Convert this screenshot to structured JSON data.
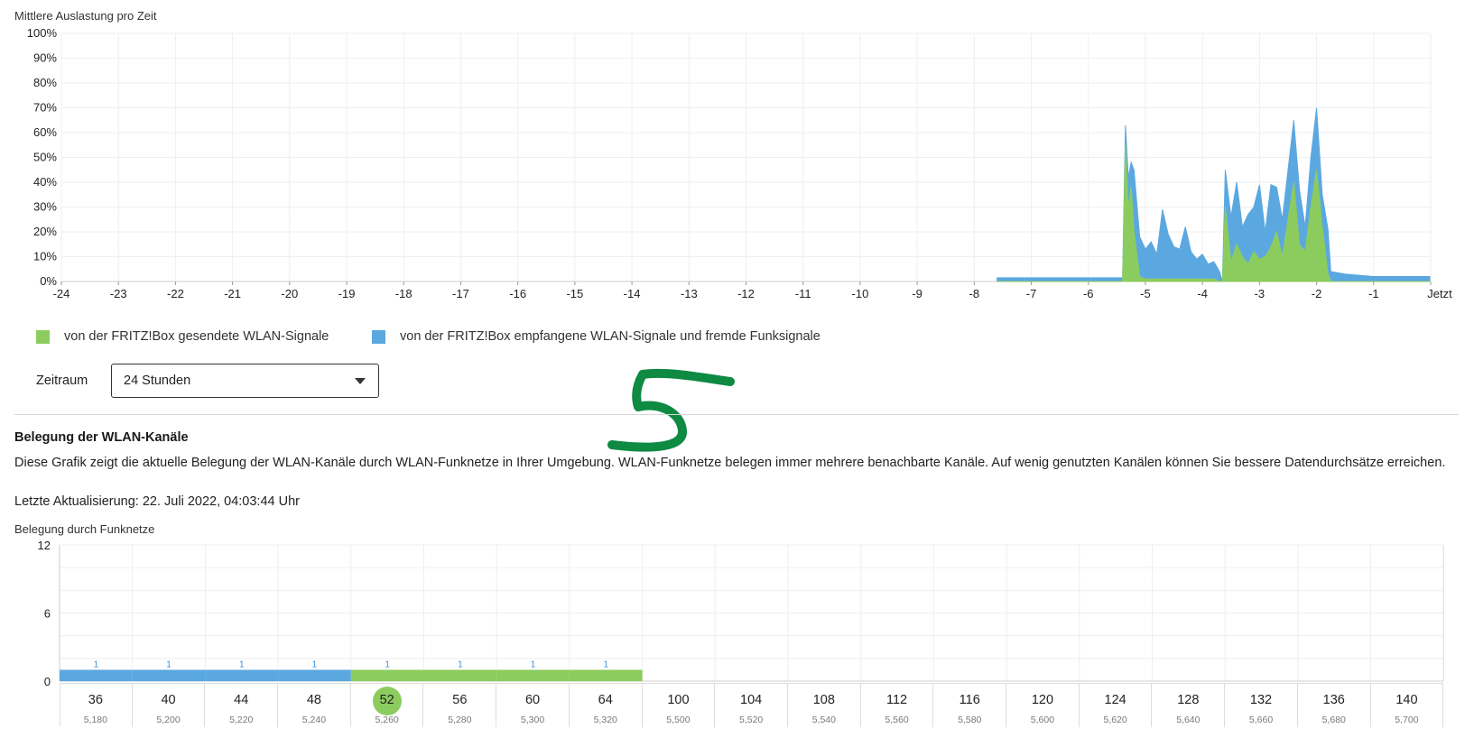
{
  "utilization": {
    "title": "Mittlere Auslastung pro Zeit",
    "legend": [
      {
        "label": "von der FRITZ!Box gesendete WLAN-Signale",
        "color": "#8ccc5e"
      },
      {
        "label": "von der FRITZ!Box empfangene WLAN-Signale und fremde Funksignale",
        "color": "#5ba8e0"
      }
    ]
  },
  "period": {
    "label": "Zeitraum",
    "value": "24 Stunden"
  },
  "channels_section": {
    "title": "Belegung der WLAN-Kanäle",
    "description": "Diese Grafik zeigt die aktuelle Belegung der WLAN-Kanäle durch WLAN-Funknetze in Ihrer Umgebung. WLAN-Funknetze belegen immer mehrere benachbarte Kanäle. Auf wenig genutzten Kanälen können Sie bessere Datendurchsätze erreichen.",
    "last_update": "Letzte Aktualisierung: 22. Juli 2022, 04:03:44 Uhr",
    "chart_title": "Belegung durch Funknetze",
    "annotation": "5"
  },
  "chart_data": [
    {
      "type": "area",
      "title": "Mittlere Auslastung pro Zeit",
      "xlabel": "",
      "ylabel": "",
      "x_ticks": [
        "-24",
        "-23",
        "-22",
        "-21",
        "-20",
        "-19",
        "-18",
        "-17",
        "-16",
        "-15",
        "-14",
        "-13",
        "-12",
        "-11",
        "-10",
        "-9",
        "-8",
        "-7",
        "-6",
        "-5",
        "-4",
        "-3",
        "-2",
        "-1",
        "Jetzt"
      ],
      "y_ticks": [
        "0%",
        "10%",
        "20%",
        "30%",
        "40%",
        "50%",
        "60%",
        "70%",
        "80%",
        "90%",
        "100%"
      ],
      "xlim": [
        -24,
        0
      ],
      "ylim": [
        0,
        100
      ],
      "grid": true,
      "legend_position": "bottom-left",
      "series": [
        {
          "name": "von der FRITZ!Box gesendete WLAN-Signale",
          "color": "#8ccc5e",
          "x": [
            -7.6,
            -5.4,
            -5.35,
            -5.3,
            -5.25,
            -5.2,
            -5.1,
            -5.0,
            -4.9,
            -4.8,
            -4.7,
            -4.6,
            -4.5,
            -4.4,
            -4.3,
            -4.2,
            -4.1,
            -4.0,
            -3.9,
            -3.8,
            -3.7,
            -3.65,
            -3.6,
            -3.5,
            -3.4,
            -3.3,
            -3.2,
            -3.1,
            -3.0,
            -2.9,
            -2.8,
            -2.7,
            -2.6,
            -2.5,
            -2.4,
            -2.3,
            -2.2,
            -2.1,
            -2.0,
            -1.9,
            -1.8,
            -1.75,
            -1.5,
            -1.0,
            -0.5,
            0
          ],
          "y": [
            0,
            0,
            55,
            30,
            38,
            20,
            2,
            1,
            1,
            1,
            1,
            1,
            1,
            1,
            1,
            1,
            1,
            1,
            1,
            1,
            0,
            0,
            30,
            8,
            15,
            10,
            7,
            12,
            9,
            10,
            14,
            20,
            10,
            25,
            40,
            15,
            12,
            30,
            45,
            22,
            3,
            0,
            0,
            0,
            0,
            0
          ]
        },
        {
          "name": "von der FRITZ!Box empfangene WLAN-Signale und fremde Funksignale",
          "color": "#5ba8e0",
          "x": [
            -7.6,
            -5.4,
            -5.35,
            -5.3,
            -5.25,
            -5.2,
            -5.1,
            -5.0,
            -4.9,
            -4.8,
            -4.7,
            -4.6,
            -4.5,
            -4.4,
            -4.3,
            -4.2,
            -4.1,
            -4.0,
            -3.9,
            -3.8,
            -3.7,
            -3.65,
            -3.6,
            -3.5,
            -3.4,
            -3.3,
            -3.2,
            -3.1,
            -3.0,
            -2.9,
            -2.8,
            -2.7,
            -2.6,
            -2.5,
            -2.4,
            -2.3,
            -2.2,
            -2.1,
            -2.0,
            -1.9,
            -1.8,
            -1.75,
            -1.5,
            -1.0,
            -0.5,
            0
          ],
          "y": [
            1.5,
            1.5,
            8,
            12,
            10,
            25,
            16,
            12,
            15,
            10,
            28,
            18,
            13,
            12,
            21,
            11,
            8,
            10,
            6,
            7,
            4,
            0,
            15,
            18,
            25,
            12,
            20,
            18,
            30,
            10,
            25,
            18,
            15,
            20,
            25,
            22,
            10,
            20,
            25,
            13,
            18,
            4,
            3,
            2,
            2,
            2
          ]
        }
      ]
    },
    {
      "type": "bar",
      "title": "Belegung durch Funknetze",
      "xlabel": "",
      "ylabel": "",
      "ylim": [
        0,
        12
      ],
      "y_ticks": [
        0,
        6,
        12
      ],
      "channels": [
        "36",
        "40",
        "44",
        "48",
        "52",
        "56",
        "60",
        "64",
        "100",
        "104",
        "108",
        "112",
        "116",
        "120",
        "124",
        "128",
        "132",
        "136",
        "140"
      ],
      "frequencies": [
        "5,180",
        "5,200",
        "5,220",
        "5,240",
        "5,260",
        "5,280",
        "5,300",
        "5,320",
        "5,500",
        "5,520",
        "5,540",
        "5,560",
        "5,580",
        "5,600",
        "5,620",
        "5,640",
        "5,660",
        "5,680",
        "5,700"
      ],
      "active_channel": "52",
      "series": [
        {
          "color": "#5ba8e0",
          "values": [
            1,
            1,
            1,
            1,
            0,
            0,
            0,
            0,
            0,
            0,
            0,
            0,
            0,
            0,
            0,
            0,
            0,
            0,
            0
          ]
        },
        {
          "color": "#8ccc5e",
          "values": [
            0,
            0,
            0,
            0,
            1,
            1,
            1,
            1,
            0,
            0,
            0,
            0,
            0,
            0,
            0,
            0,
            0,
            0,
            0
          ]
        }
      ],
      "data_labels": [
        "1",
        "1",
        "1",
        "1",
        "1",
        "1",
        "1",
        "1",
        "",
        "",
        "",
        "",
        "",
        "",
        "",
        "",
        "",
        "",
        ""
      ]
    }
  ]
}
